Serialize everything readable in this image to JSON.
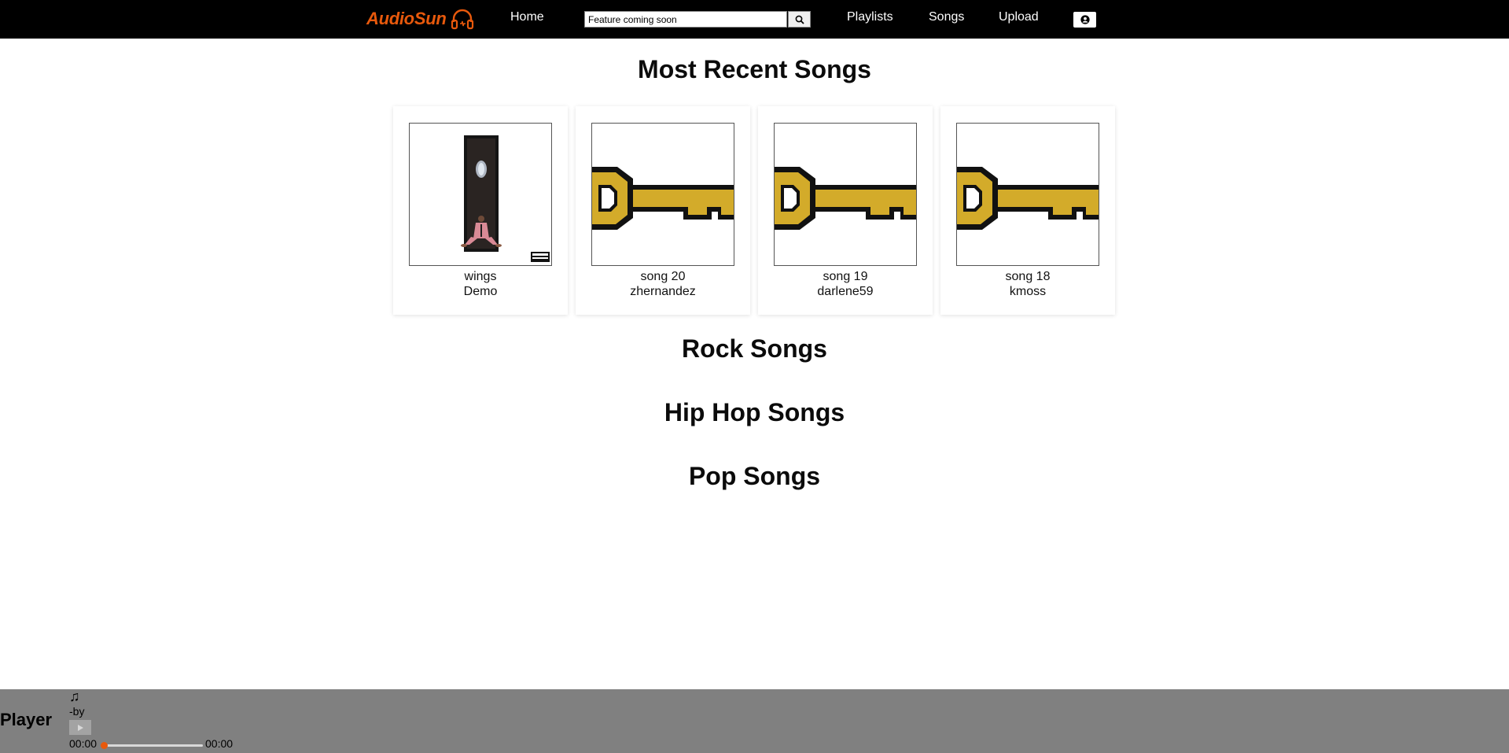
{
  "brand": {
    "name": "AudioSun",
    "color": "#e8590c",
    "icon": "headphones-icon"
  },
  "nav": {
    "home": "Home",
    "search_placeholder": "Feature coming soon",
    "search_icon": "magnifier-icon",
    "playlists": "Playlists",
    "songs": "Songs",
    "upload": "Upload",
    "profile_icon": "user-circle-icon"
  },
  "sections": {
    "recent": "Most Recent Songs",
    "rock": "Rock Songs",
    "hiphop": "Hip Hop Songs",
    "pop": "Pop Songs"
  },
  "recent_songs": [
    {
      "title": "wings",
      "artist": "Demo",
      "art": "album-cover-man-in-doorway"
    },
    {
      "title": "song 20",
      "artist": "zhernandez",
      "art": "gold-key-icon"
    },
    {
      "title": "song 19",
      "artist": "darlene59",
      "art": "gold-key-icon"
    },
    {
      "title": "song 18",
      "artist": "kmoss",
      "art": "gold-key-icon"
    }
  ],
  "player": {
    "label": "Player",
    "note_icon": "♫",
    "now_playing": "-by",
    "current_time": "00:00",
    "duration": "00:00",
    "progress": 0,
    "accent": "#e8590c",
    "bar_color": "#808080"
  }
}
